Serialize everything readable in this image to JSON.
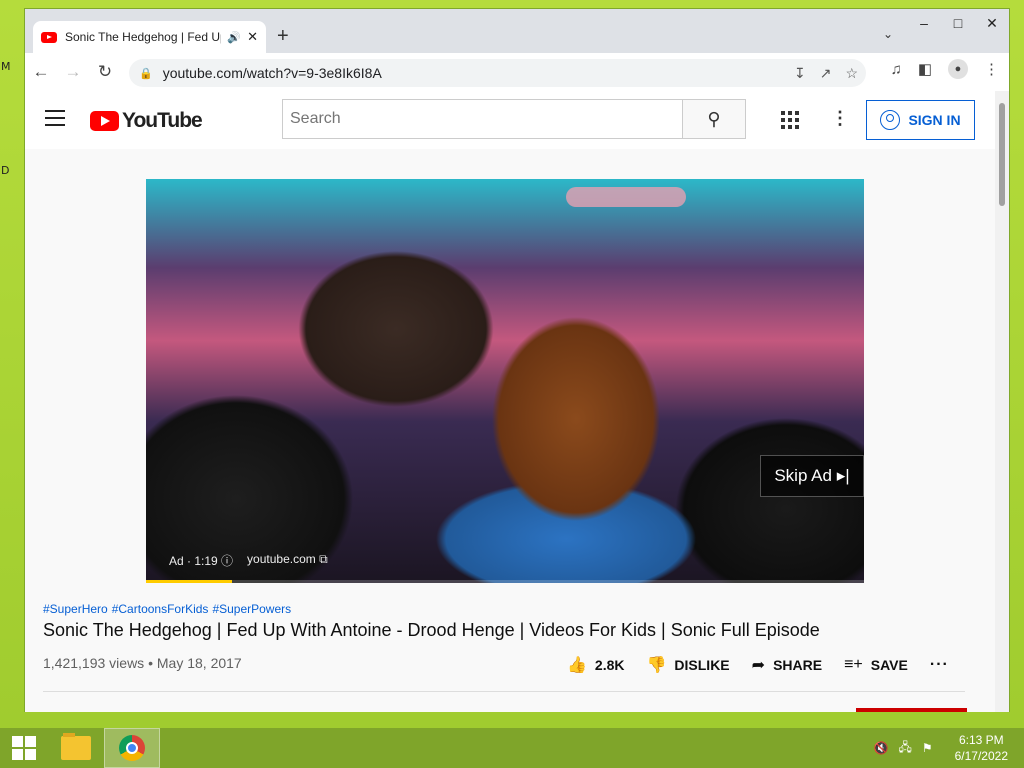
{
  "browser": {
    "tab_title": "Sonic The Hedgehog | Fed Up With Antoine",
    "new_tab": "+",
    "url": "youtube.com/watch?v=9-3e8Ik6I8A"
  },
  "youtube": {
    "logo_text": "YouTube",
    "search_placeholder": "Search",
    "sign_in": "SIGN IN"
  },
  "player": {
    "skip_ad": "Skip Ad ▸|",
    "ad_time": "Ad · 1:19",
    "ad_domain": "youtube.com",
    "progress": 0.12
  },
  "video": {
    "hashtags": [
      "#SuperHero",
      "#CartoonsForKids",
      "#SuperPowers"
    ],
    "title": "Sonic The Hedgehog | Fed Up With Antoine - Drood Henge | Videos For Kids | Sonic Full Episode",
    "views": "1,421,193 views",
    "date": "May 18, 2017",
    "likes": "2.8K",
    "dislike": "DISLIKE",
    "share": "SHARE",
    "save": "SAVE"
  },
  "taskbar": {
    "time": "6:13 PM",
    "date": "6/17/2022"
  },
  "desktop": {
    "glyph_1": "M",
    "glyph_2": "D"
  },
  "colors": {
    "accent_blue": "#065fd4",
    "youtube_red": "#ff0000",
    "ad_progress": "#ffcc00",
    "desktop_green": "#a6d13a"
  }
}
